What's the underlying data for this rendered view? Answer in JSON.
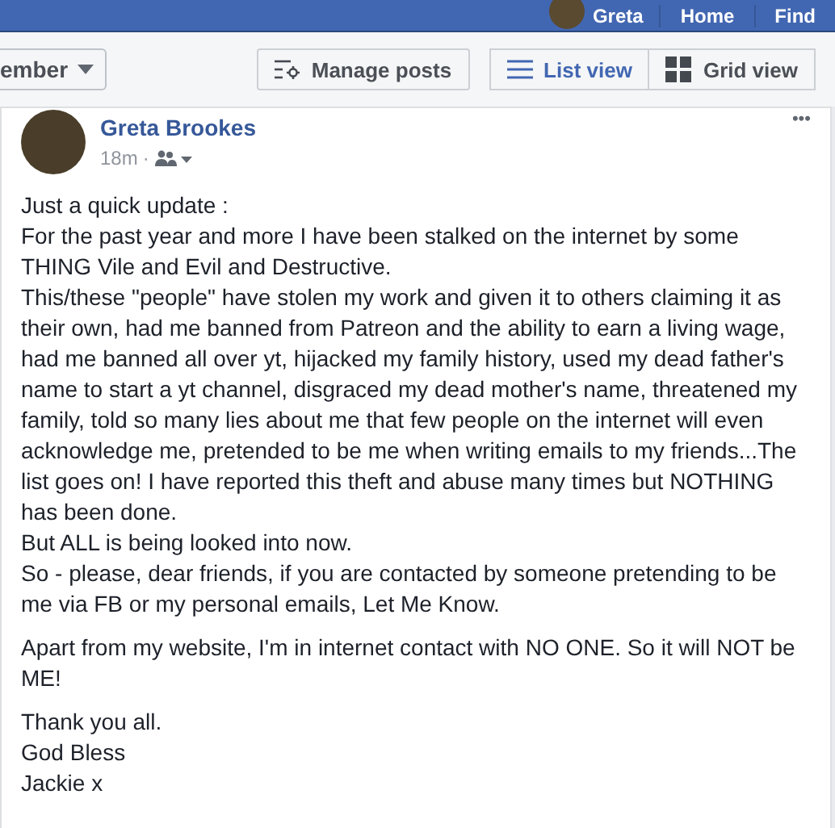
{
  "top_bar": {
    "user": "Greta",
    "links": [
      "Home",
      "Find"
    ]
  },
  "toolbar": {
    "filter": "ember",
    "manage": "Manage posts",
    "views": [
      {
        "label": "List view",
        "kind": "list",
        "selected": true
      },
      {
        "label": "Grid view",
        "kind": "grid",
        "selected": false
      }
    ]
  },
  "post": {
    "author": "Greta Brookes",
    "time": "18m",
    "separator": "·",
    "more": "•••",
    "paragraphs": [
      [
        "Just a quick update :",
        "For the past year and more I have been stalked on the internet by some THING Vile and Evil and Destructive.",
        "This/these \"people\" have stolen my work and given it to others claiming it as their own, had me banned from Patreon and the ability to earn a living wage, had me banned all over yt, hijacked my family history, used my dead father's name to start a yt channel, disgraced my dead mother's name, threatened my family, told so many lies about me that few people on the internet will even acknowledge me, pretended to be me when writing emails to my friends...The list goes on! I have reported this theft and abuse many times but NOTHING has been done.",
        "But ALL is being looked into now.",
        "So - please, dear friends, if you are contacted by someone pretending to be me via FB or my personal emails, Let Me Know."
      ],
      [
        "Apart from my website, I'm in internet contact with NO ONE. So it will NOT be ME!"
      ],
      [
        "Thank you all.",
        "God Bless",
        "Jackie x"
      ]
    ]
  }
}
